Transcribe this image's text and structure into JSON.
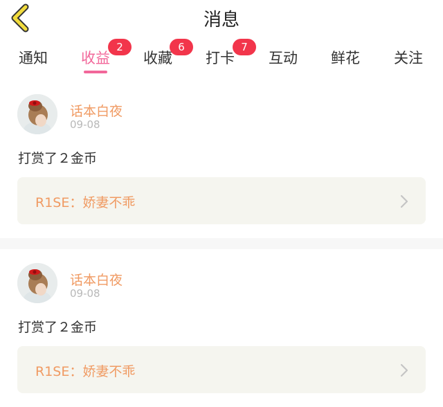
{
  "header": {
    "title": "消息",
    "back_icon": "chevron-left-icon"
  },
  "tabs": [
    {
      "label": "通知",
      "badge": ""
    },
    {
      "label": "收益",
      "badge": "2",
      "active": true
    },
    {
      "label": "收藏",
      "badge": "6"
    },
    {
      "label": "打卡",
      "badge": "7"
    },
    {
      "label": "互动",
      "badge": ""
    },
    {
      "label": "鲜花",
      "badge": ""
    },
    {
      "label": "关注",
      "badge": ""
    }
  ],
  "messages": [
    {
      "user": "话本白夜",
      "date": "09-08",
      "action": "打赏了２金币",
      "work": "R1SE：娇妻不乖"
    },
    {
      "user": "话本白夜",
      "date": "09-08",
      "action": "打赏了２金币",
      "work": "R1SE：娇妻不乖"
    }
  ],
  "colors": {
    "accent": "#f2679a",
    "badge": "#f2354b",
    "name": "#f09a62",
    "card": "#f5f5ef",
    "back_icon": "#f2dc3d"
  }
}
